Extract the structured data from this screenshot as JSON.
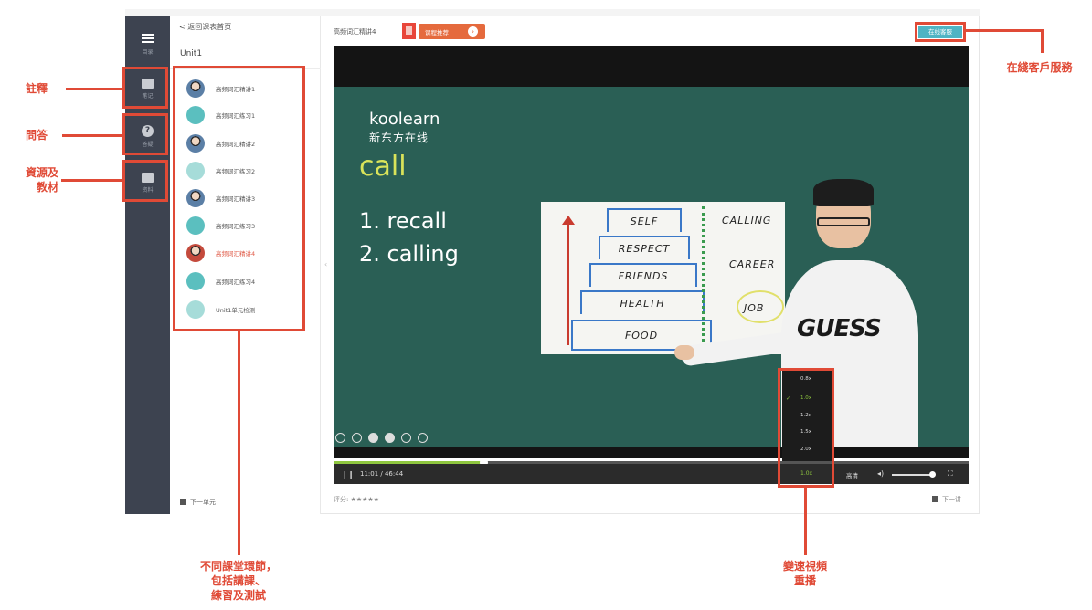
{
  "nav": {
    "items": [
      {
        "label": "目录",
        "icon": "menu-icon"
      },
      {
        "label": "笔记",
        "icon": "note-edit-icon"
      },
      {
        "label": "答疑",
        "icon": "question-icon"
      },
      {
        "label": "资料",
        "icon": "file-icon"
      }
    ]
  },
  "sidebar": {
    "back_label": "< 返回课表首页",
    "unit_title": "Unit1",
    "lessons": [
      {
        "title": "高频词汇精讲1",
        "type": "lecture",
        "active": false
      },
      {
        "title": "高频词汇练习1",
        "type": "exercise",
        "active": false
      },
      {
        "title": "高频词汇精讲2",
        "type": "lecture",
        "active": false
      },
      {
        "title": "高频词汇练习2",
        "type": "exercise",
        "active": false
      },
      {
        "title": "高频词汇精讲3",
        "type": "lecture",
        "active": false
      },
      {
        "title": "高频词汇练习3",
        "type": "exercise",
        "active": false
      },
      {
        "title": "高频词汇精讲4",
        "type": "lecture",
        "active": true
      },
      {
        "title": "高频词汇练习4",
        "type": "exercise",
        "active": false
      },
      {
        "title": "Unit1单元检测",
        "type": "test",
        "active": false
      }
    ],
    "next_unit_label": "下一单元"
  },
  "player": {
    "lesson_title": "高频词汇精讲4",
    "recommend_label": "课程推荐",
    "online_service_label": "在线客服",
    "slide": {
      "logo_en": "koolearn",
      "logo_cn": "新东方在线",
      "word": "call",
      "point1": "1. recall",
      "point2": "2. calling",
      "pyramid": [
        "SELF",
        "RESPECT",
        "FRIENDS",
        "HEALTH",
        "FOOD"
      ],
      "right_words": [
        "CALLING",
        "CAREER",
        "JOB"
      ],
      "shirt_text": "GUESS"
    },
    "controls": {
      "pause_icon": "pause-icon",
      "time": "11:01 / 46:44",
      "speed_current": "1.0x",
      "quality": "高清",
      "progress": 0.236
    },
    "speed_menu": [
      "0.8x",
      "1.0x",
      "1.2x",
      "1.5x",
      "2.0x"
    ],
    "speed_selected": "1.0x",
    "rating_label": "评分: ★★★★★",
    "next_lesson_label": "下一讲"
  },
  "annotations": {
    "notes": "註釋",
    "qa": "問答",
    "resources": "資源及\n教材",
    "online_service": "在綫客戶服務",
    "lessons": "不同課堂環節，\n包括講課、\n練習及測試",
    "speed": "變速視頻\n重播"
  },
  "colors": {
    "annotation": "#e04a36",
    "nav_bg": "#3d4350",
    "board": "#2a5f55",
    "accent_green": "#8ec63f",
    "service_button": "#4fb4c4"
  }
}
